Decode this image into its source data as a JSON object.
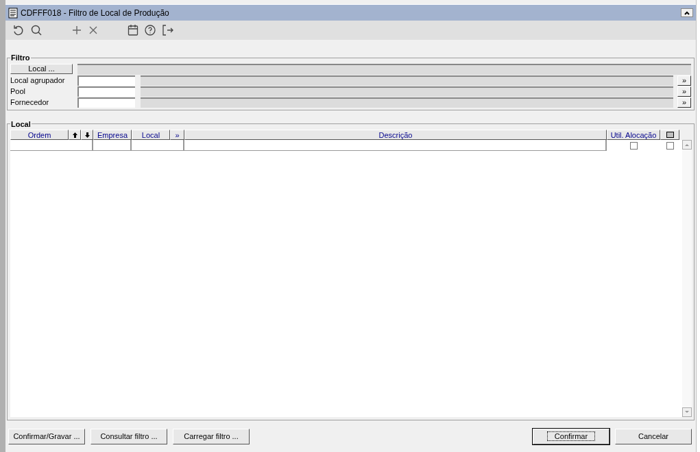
{
  "window": {
    "title": "CDFFF018 - Filtro de Local de Produção"
  },
  "filter": {
    "title": "Filtro",
    "local_button": "Local ...",
    "rows": [
      {
        "label": "Local agrupador",
        "lookup": "»"
      },
      {
        "label": "Pool",
        "lookup": "»"
      },
      {
        "label": "Fornecedor",
        "lookup": "»"
      }
    ]
  },
  "grid": {
    "title": "Local",
    "columns": [
      {
        "kind": "text",
        "label": "Ordem"
      },
      {
        "kind": "up"
      },
      {
        "kind": "down"
      },
      {
        "kind": "text",
        "label": "Empresa"
      },
      {
        "kind": "text",
        "label": "Local"
      },
      {
        "kind": "text",
        "label": "»"
      },
      {
        "kind": "text",
        "label": "Descrição"
      },
      {
        "kind": "text",
        "label": "Util. Alocação"
      },
      {
        "kind": "box"
      }
    ],
    "rows": [
      {
        "util_alocacao": false,
        "selected": false
      }
    ]
  },
  "buttons_left": [
    "Confirmar/Gravar ...",
    "Consultar filtro ...",
    "Carregar filtro ..."
  ],
  "buttons_right": [
    {
      "label": "Confirmar",
      "default": true
    },
    {
      "label": "Cancelar",
      "default": false
    }
  ]
}
